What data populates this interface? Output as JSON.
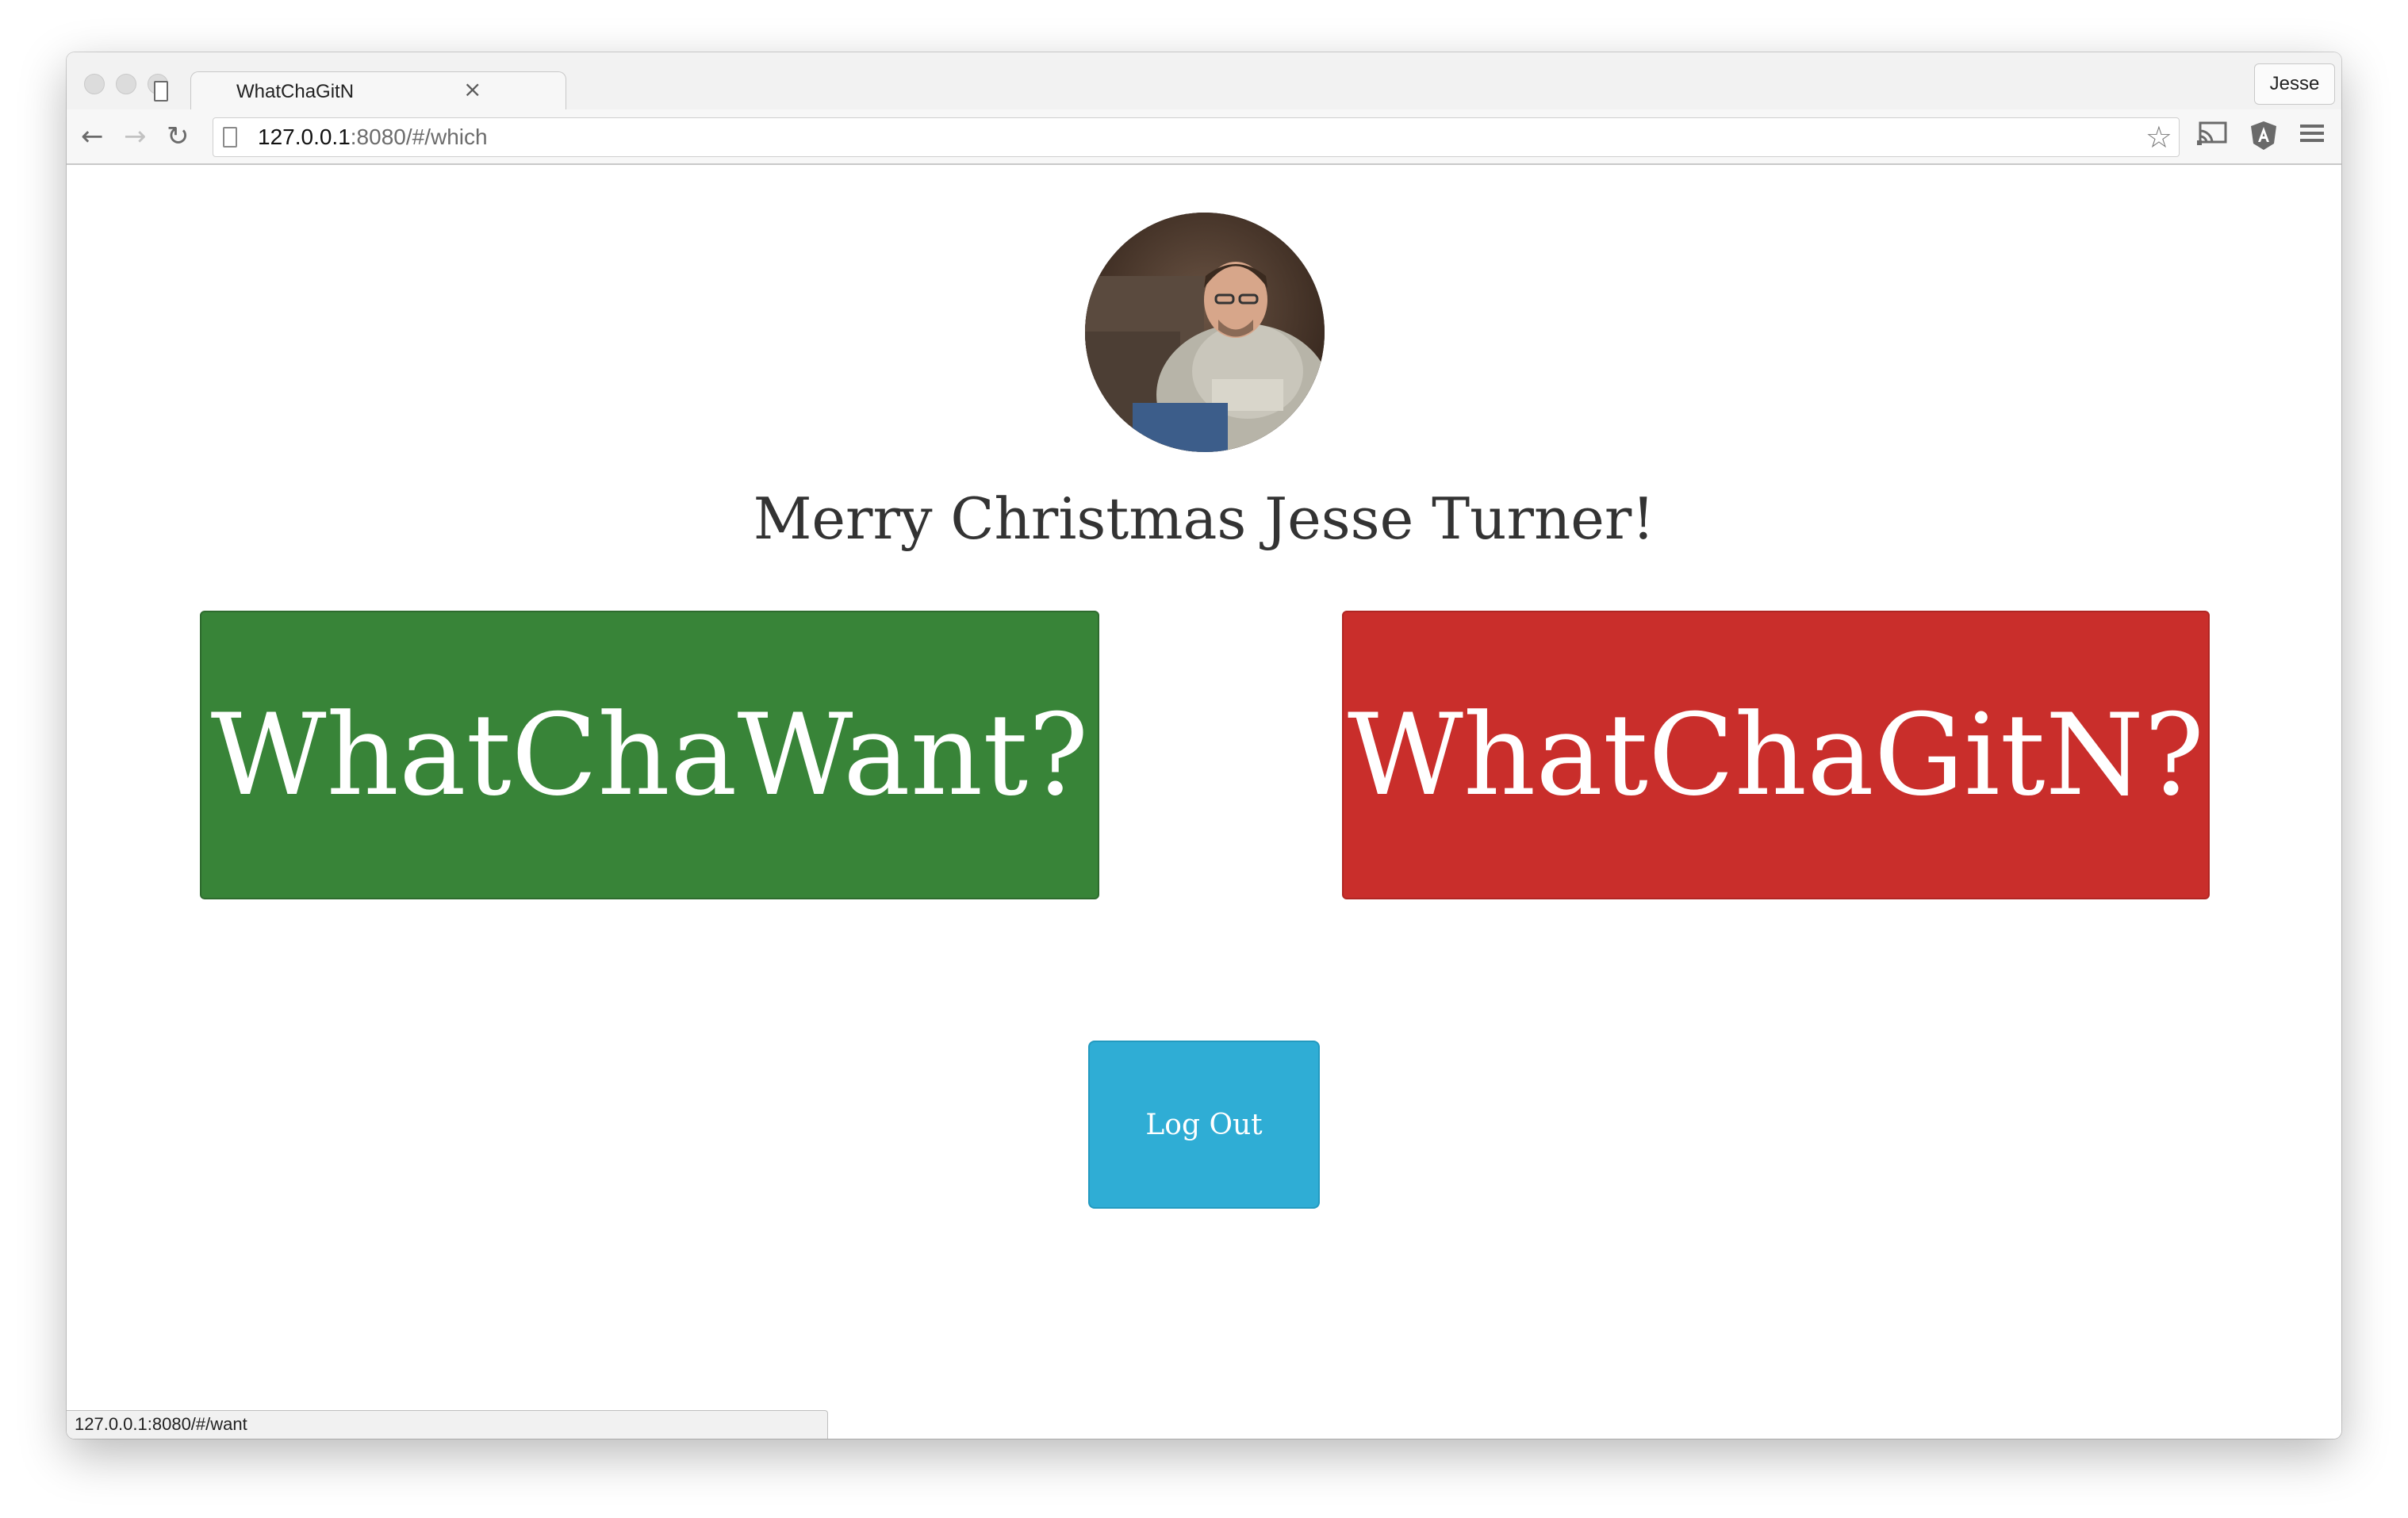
{
  "browser": {
    "tab_title": "WhatChaGitN",
    "tab_close_glyph": "×",
    "profile_name": "Jesse",
    "url_host": "127.0.0.1",
    "url_rest": ":8080/#/which",
    "status_url": "127.0.0.1:8080/#/want",
    "icons": {
      "back": "back-arrow-icon",
      "forward": "forward-arrow-icon",
      "reload": "reload-icon",
      "page": "page-icon",
      "bookmark": "bookmark-star-icon",
      "cast": "cast-icon",
      "angular": "angular-extension-icon",
      "menu": "menu-icon"
    }
  },
  "page": {
    "greeting": "Merry Christmas Jesse Turner!",
    "want_button": "WhatChaWant?",
    "gitn_button": "WhatChaGitN?",
    "logout_button": "Log Out"
  },
  "colors": {
    "want": "#388438",
    "gitn": "#c92e2b",
    "logout": "#2fadd5",
    "greeting_text": "#333333"
  }
}
